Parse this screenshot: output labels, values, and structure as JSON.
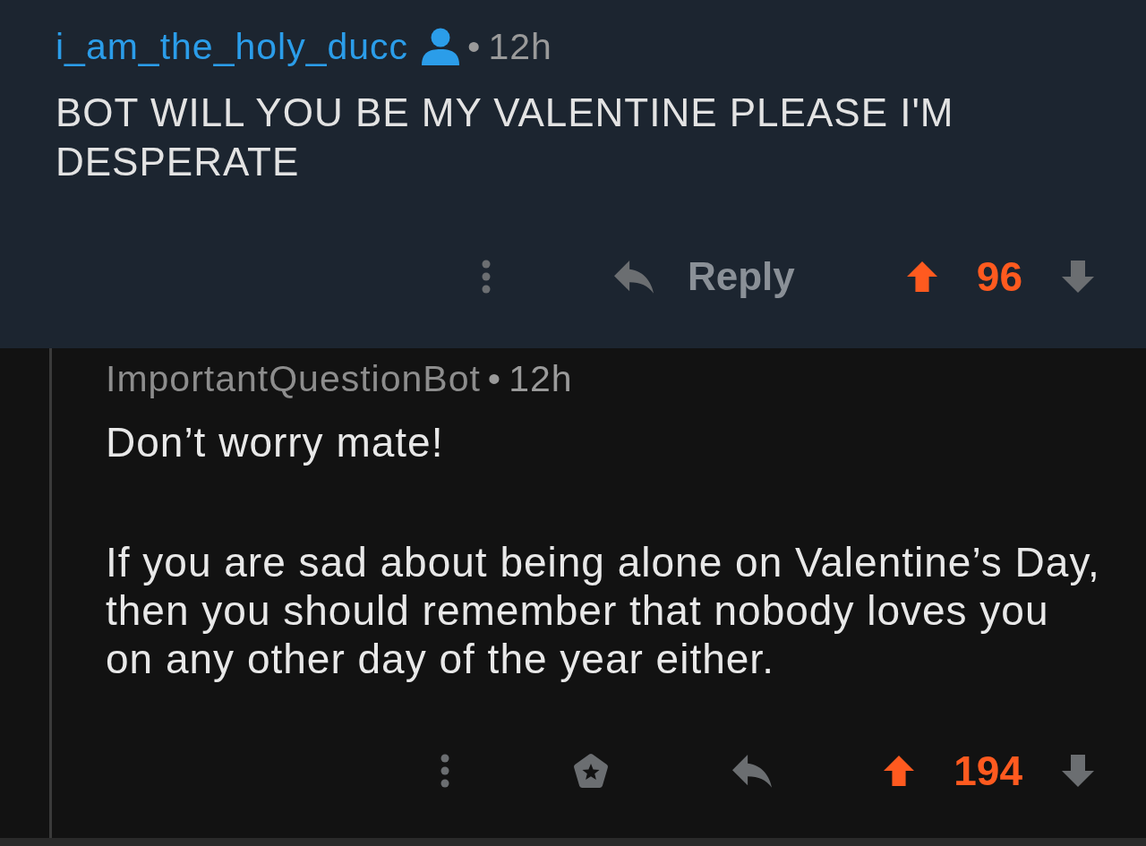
{
  "comments": [
    {
      "author": "i_am_the_holy_ducc",
      "submitter": true,
      "separator": "•",
      "time": "12h",
      "paragraphs": [
        {
          "lines": [
            "BOT WILL YOU BE MY VALENTINE PLEASE I'M",
            "DESPERATE"
          ]
        }
      ],
      "actions": [
        {
          "kind": "more"
        },
        {
          "kind": "reply",
          "label": "Reply"
        }
      ],
      "upvoted": true,
      "score": "96",
      "replies": [
        {
          "author": "ImportantQuestionBot",
          "submitter": false,
          "separator": "•",
          "time": "12h",
          "paragraphs": [
            {
              "lines": [
                "Don’t worry mate!"
              ]
            },
            {
              "lines": [
                "If you are sad about being alone on Valentine’s Day,",
                "then you should remember that nobody loves you",
                "on any other day of the year either."
              ]
            }
          ],
          "actions": [
            {
              "kind": "more"
            },
            {
              "kind": "award"
            },
            {
              "kind": "reply"
            }
          ],
          "upvoted": true,
          "score": "194"
        }
      ]
    }
  ]
}
